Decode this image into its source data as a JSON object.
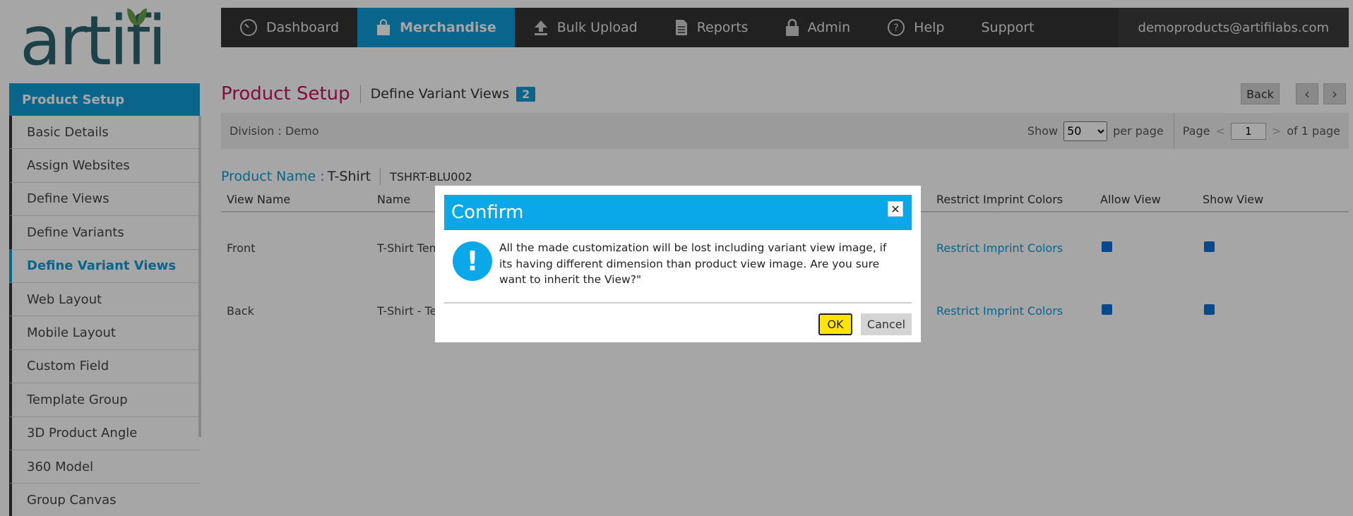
{
  "logo": {
    "text": "artifi"
  },
  "nav": {
    "items": [
      {
        "label": "Dashboard",
        "icon": "dashboard-gauge-icon"
      },
      {
        "label": "Merchandise",
        "icon": "shopping-bag-icon",
        "active": true
      },
      {
        "label": "Bulk Upload",
        "icon": "upload-icon"
      },
      {
        "label": "Reports",
        "icon": "document-icon"
      },
      {
        "label": "Admin",
        "icon": "lock-icon"
      },
      {
        "label": "Help",
        "icon": "help-circle-icon"
      },
      {
        "label": "Support"
      }
    ],
    "user": "demoproducts@artifilabs.com"
  },
  "sidebar": {
    "header": "Product Setup",
    "items": [
      {
        "label": "Basic Details"
      },
      {
        "label": "Assign Websites"
      },
      {
        "label": "Define Views"
      },
      {
        "label": "Define Variants"
      },
      {
        "label": "Define Variant Views",
        "active": true
      },
      {
        "label": "Web Layout"
      },
      {
        "label": "Mobile Layout"
      },
      {
        "label": "Custom Field"
      },
      {
        "label": "Template Group"
      },
      {
        "label": "3D Product Angle"
      },
      {
        "label": "360 Model"
      },
      {
        "label": "Group Canvas"
      }
    ]
  },
  "page": {
    "title": "Product Setup",
    "subtitle": "Define Variant Views",
    "badge": "2",
    "back_label": "Back",
    "prev_icon": "chevron-left-icon",
    "next_icon": "chevron-right-icon"
  },
  "filter": {
    "division_label": "Division :",
    "division_value": "Demo",
    "show_label": "Show",
    "per_page_value": "50",
    "per_page_label": "per page",
    "page_label": "Page",
    "page_prev": "<",
    "page_value": "1",
    "page_next": ">",
    "page_of": "of 1 page"
  },
  "product": {
    "name_label": "Product Name :",
    "name_value": "T-Shirt",
    "sku": "TSHRT-BLU002"
  },
  "table": {
    "headers": {
      "view_name": "View Name",
      "name": "Name",
      "restrict": "Restrict Imprint Colors",
      "allow": "Allow View",
      "show": "Show View"
    },
    "rows": [
      {
        "view_name": "Front",
        "name": "T-Shirt Tem",
        "restrict": "Restrict Imprint Colors",
        "allow": true,
        "show": true
      },
      {
        "view_name": "Back",
        "name": "T-Shirt - Te",
        "restrict": "Restrict Imprint Colors",
        "allow": true,
        "show": true
      }
    ]
  },
  "modal": {
    "title": "Confirm",
    "close_icon": "close-icon",
    "alert_icon": "exclamation-icon",
    "alert_glyph": "!",
    "message": "All the made customization will be lost including variant view image, if its having different dimension than product view image. Are you sure want to inherit the View?\"",
    "ok_label": "OK",
    "cancel_label": "Cancel"
  },
  "colors": {
    "accent": "#0e9bd8",
    "title": "#c2185b",
    "nav_bg": "#333333",
    "ok_button": "#ffe500"
  }
}
